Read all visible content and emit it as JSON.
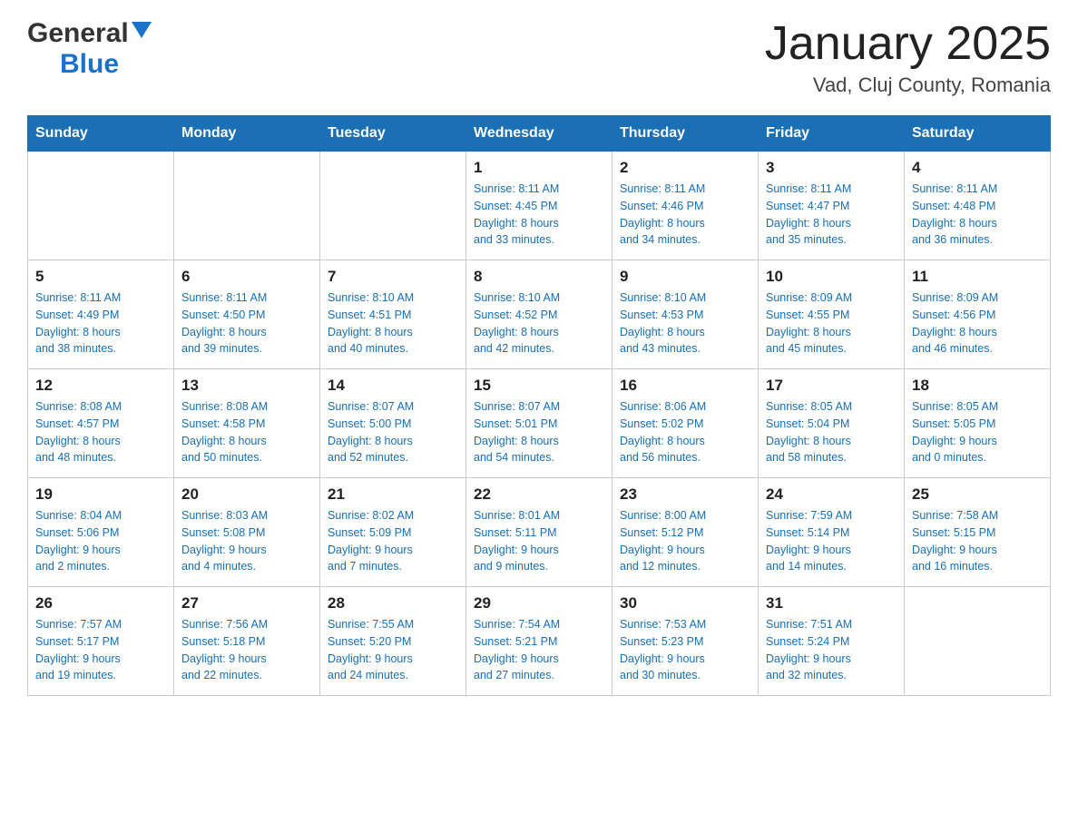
{
  "logo": {
    "text_general": "General",
    "text_blue": "Blue"
  },
  "title": "January 2025",
  "subtitle": "Vad, Cluj County, Romania",
  "days_of_week": [
    "Sunday",
    "Monday",
    "Tuesday",
    "Wednesday",
    "Thursday",
    "Friday",
    "Saturday"
  ],
  "weeks": [
    [
      {
        "day": "",
        "info": ""
      },
      {
        "day": "",
        "info": ""
      },
      {
        "day": "",
        "info": ""
      },
      {
        "day": "1",
        "info": "Sunrise: 8:11 AM\nSunset: 4:45 PM\nDaylight: 8 hours\nand 33 minutes."
      },
      {
        "day": "2",
        "info": "Sunrise: 8:11 AM\nSunset: 4:46 PM\nDaylight: 8 hours\nand 34 minutes."
      },
      {
        "day": "3",
        "info": "Sunrise: 8:11 AM\nSunset: 4:47 PM\nDaylight: 8 hours\nand 35 minutes."
      },
      {
        "day": "4",
        "info": "Sunrise: 8:11 AM\nSunset: 4:48 PM\nDaylight: 8 hours\nand 36 minutes."
      }
    ],
    [
      {
        "day": "5",
        "info": "Sunrise: 8:11 AM\nSunset: 4:49 PM\nDaylight: 8 hours\nand 38 minutes."
      },
      {
        "day": "6",
        "info": "Sunrise: 8:11 AM\nSunset: 4:50 PM\nDaylight: 8 hours\nand 39 minutes."
      },
      {
        "day": "7",
        "info": "Sunrise: 8:10 AM\nSunset: 4:51 PM\nDaylight: 8 hours\nand 40 minutes."
      },
      {
        "day": "8",
        "info": "Sunrise: 8:10 AM\nSunset: 4:52 PM\nDaylight: 8 hours\nand 42 minutes."
      },
      {
        "day": "9",
        "info": "Sunrise: 8:10 AM\nSunset: 4:53 PM\nDaylight: 8 hours\nand 43 minutes."
      },
      {
        "day": "10",
        "info": "Sunrise: 8:09 AM\nSunset: 4:55 PM\nDaylight: 8 hours\nand 45 minutes."
      },
      {
        "day": "11",
        "info": "Sunrise: 8:09 AM\nSunset: 4:56 PM\nDaylight: 8 hours\nand 46 minutes."
      }
    ],
    [
      {
        "day": "12",
        "info": "Sunrise: 8:08 AM\nSunset: 4:57 PM\nDaylight: 8 hours\nand 48 minutes."
      },
      {
        "day": "13",
        "info": "Sunrise: 8:08 AM\nSunset: 4:58 PM\nDaylight: 8 hours\nand 50 minutes."
      },
      {
        "day": "14",
        "info": "Sunrise: 8:07 AM\nSunset: 5:00 PM\nDaylight: 8 hours\nand 52 minutes."
      },
      {
        "day": "15",
        "info": "Sunrise: 8:07 AM\nSunset: 5:01 PM\nDaylight: 8 hours\nand 54 minutes."
      },
      {
        "day": "16",
        "info": "Sunrise: 8:06 AM\nSunset: 5:02 PM\nDaylight: 8 hours\nand 56 minutes."
      },
      {
        "day": "17",
        "info": "Sunrise: 8:05 AM\nSunset: 5:04 PM\nDaylight: 8 hours\nand 58 minutes."
      },
      {
        "day": "18",
        "info": "Sunrise: 8:05 AM\nSunset: 5:05 PM\nDaylight: 9 hours\nand 0 minutes."
      }
    ],
    [
      {
        "day": "19",
        "info": "Sunrise: 8:04 AM\nSunset: 5:06 PM\nDaylight: 9 hours\nand 2 minutes."
      },
      {
        "day": "20",
        "info": "Sunrise: 8:03 AM\nSunset: 5:08 PM\nDaylight: 9 hours\nand 4 minutes."
      },
      {
        "day": "21",
        "info": "Sunrise: 8:02 AM\nSunset: 5:09 PM\nDaylight: 9 hours\nand 7 minutes."
      },
      {
        "day": "22",
        "info": "Sunrise: 8:01 AM\nSunset: 5:11 PM\nDaylight: 9 hours\nand 9 minutes."
      },
      {
        "day": "23",
        "info": "Sunrise: 8:00 AM\nSunset: 5:12 PM\nDaylight: 9 hours\nand 12 minutes."
      },
      {
        "day": "24",
        "info": "Sunrise: 7:59 AM\nSunset: 5:14 PM\nDaylight: 9 hours\nand 14 minutes."
      },
      {
        "day": "25",
        "info": "Sunrise: 7:58 AM\nSunset: 5:15 PM\nDaylight: 9 hours\nand 16 minutes."
      }
    ],
    [
      {
        "day": "26",
        "info": "Sunrise: 7:57 AM\nSunset: 5:17 PM\nDaylight: 9 hours\nand 19 minutes."
      },
      {
        "day": "27",
        "info": "Sunrise: 7:56 AM\nSunset: 5:18 PM\nDaylight: 9 hours\nand 22 minutes."
      },
      {
        "day": "28",
        "info": "Sunrise: 7:55 AM\nSunset: 5:20 PM\nDaylight: 9 hours\nand 24 minutes."
      },
      {
        "day": "29",
        "info": "Sunrise: 7:54 AM\nSunset: 5:21 PM\nDaylight: 9 hours\nand 27 minutes."
      },
      {
        "day": "30",
        "info": "Sunrise: 7:53 AM\nSunset: 5:23 PM\nDaylight: 9 hours\nand 30 minutes."
      },
      {
        "day": "31",
        "info": "Sunrise: 7:51 AM\nSunset: 5:24 PM\nDaylight: 9 hours\nand 32 minutes."
      },
      {
        "day": "",
        "info": ""
      }
    ]
  ]
}
